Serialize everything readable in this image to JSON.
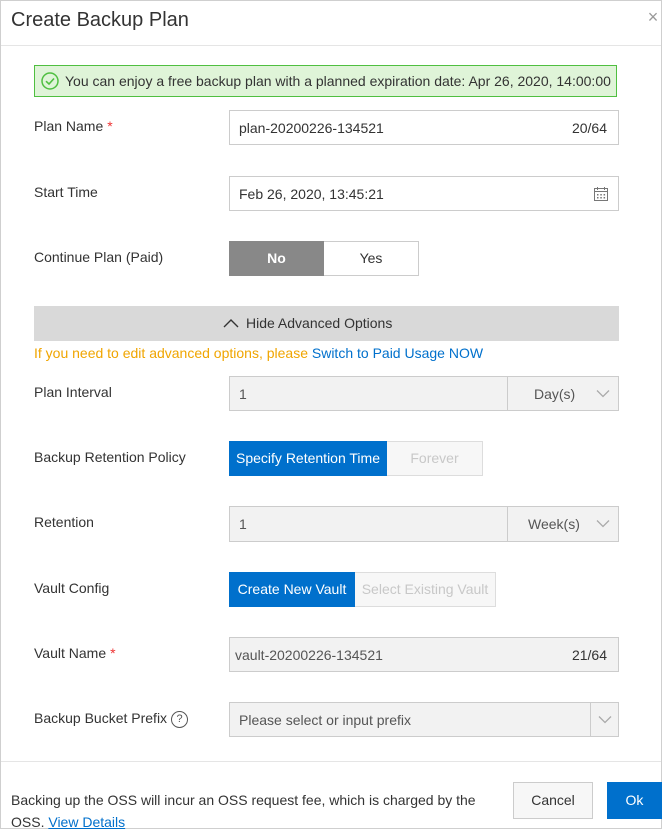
{
  "dialog": {
    "title": "Create Backup Plan",
    "close_glyph": "×"
  },
  "notice": {
    "text": "You can enjoy a free backup plan with a planned expiration date: Apr 26, 2020, 14:00:00"
  },
  "plan_name": {
    "label": "Plan Name",
    "required": "*",
    "value": "plan-20200226-134521",
    "count": "20/64"
  },
  "start_time": {
    "label": "Start Time",
    "value": "Feb 26, 2020, 13:45:21"
  },
  "continue_plan": {
    "label": "Continue Plan (Paid)",
    "no_label": "No",
    "yes_label": "Yes",
    "selected": "No"
  },
  "advanced": {
    "toggle_label": "Hide Advanced Options",
    "warning_text": "If you need to edit advanced options, please ",
    "warning_link": "Switch to Paid Usage NOW"
  },
  "plan_interval": {
    "label": "Plan Interval",
    "value": "1",
    "unit": "Day(s)"
  },
  "retention_policy": {
    "label": "Backup Retention Policy",
    "option_specify": "Specify Retention Time",
    "option_forever": "Forever",
    "selected": "Specify Retention Time"
  },
  "retention": {
    "label": "Retention",
    "value": "1",
    "unit": "Week(s)"
  },
  "vault_config": {
    "label": "Vault Config",
    "option_new": "Create New Vault",
    "option_existing": "Select Existing Vault",
    "selected": "Create New Vault"
  },
  "vault_name": {
    "label": "Vault Name",
    "required": "*",
    "value": "vault-20200226-134521",
    "count": "21/64"
  },
  "bucket_prefix": {
    "label": "Backup Bucket Prefix",
    "help_glyph": "?",
    "placeholder": "Please select or input prefix"
  },
  "footer": {
    "text": "Backing up the OSS will incur an OSS request fee, which is charged by the OSS. ",
    "link": "View Details",
    "cancel_label": "Cancel",
    "ok_label": "Ok"
  },
  "colors": {
    "primary": "#0070cc",
    "selected_gray": "#888888",
    "notice_bg": "#dff4d8",
    "notice_border": "#4fbf40",
    "warning": "#f0a500",
    "required": "#ee3333"
  },
  "icons": {
    "notice": "check-circle-icon",
    "calendar": "calendar-icon",
    "toggle": "chevron-up-icon",
    "dropdown": "chevron-down-icon",
    "help": "help-circle-icon",
    "close": "close-icon"
  }
}
